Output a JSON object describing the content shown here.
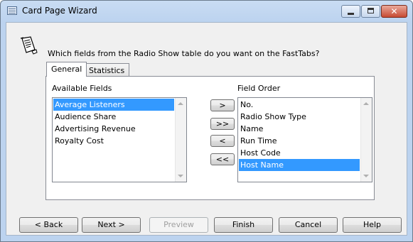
{
  "window": {
    "title": "Card Page Wizard"
  },
  "wizard": {
    "question": "Which fields from the Radio Show table do you want on the FastTabs?"
  },
  "tabs": [
    {
      "label": "General",
      "active": true
    },
    {
      "label": "Statistics",
      "active": false
    }
  ],
  "available_fields": {
    "label": "Available Fields",
    "items": [
      "Average Listeners",
      "Audience Share",
      "Advertising Revenue",
      "Royalty Cost"
    ],
    "selected": "Average Listeners"
  },
  "field_order": {
    "label": "Field Order",
    "items": [
      "No.",
      "Radio Show Type",
      "Name",
      "Run Time",
      "Host Code",
      "Host Name"
    ],
    "selected": "Host Name"
  },
  "move_buttons": {
    "add_one": ">",
    "add_all": ">>",
    "remove_one": "<",
    "remove_all": "<<"
  },
  "footer": {
    "back": "< Back",
    "next": "Next >",
    "preview": "Preview",
    "finish": "Finish",
    "cancel": "Cancel",
    "help": "Help"
  },
  "colors": {
    "selection": "#3399ff",
    "title_bar": "#bcd3ef"
  }
}
